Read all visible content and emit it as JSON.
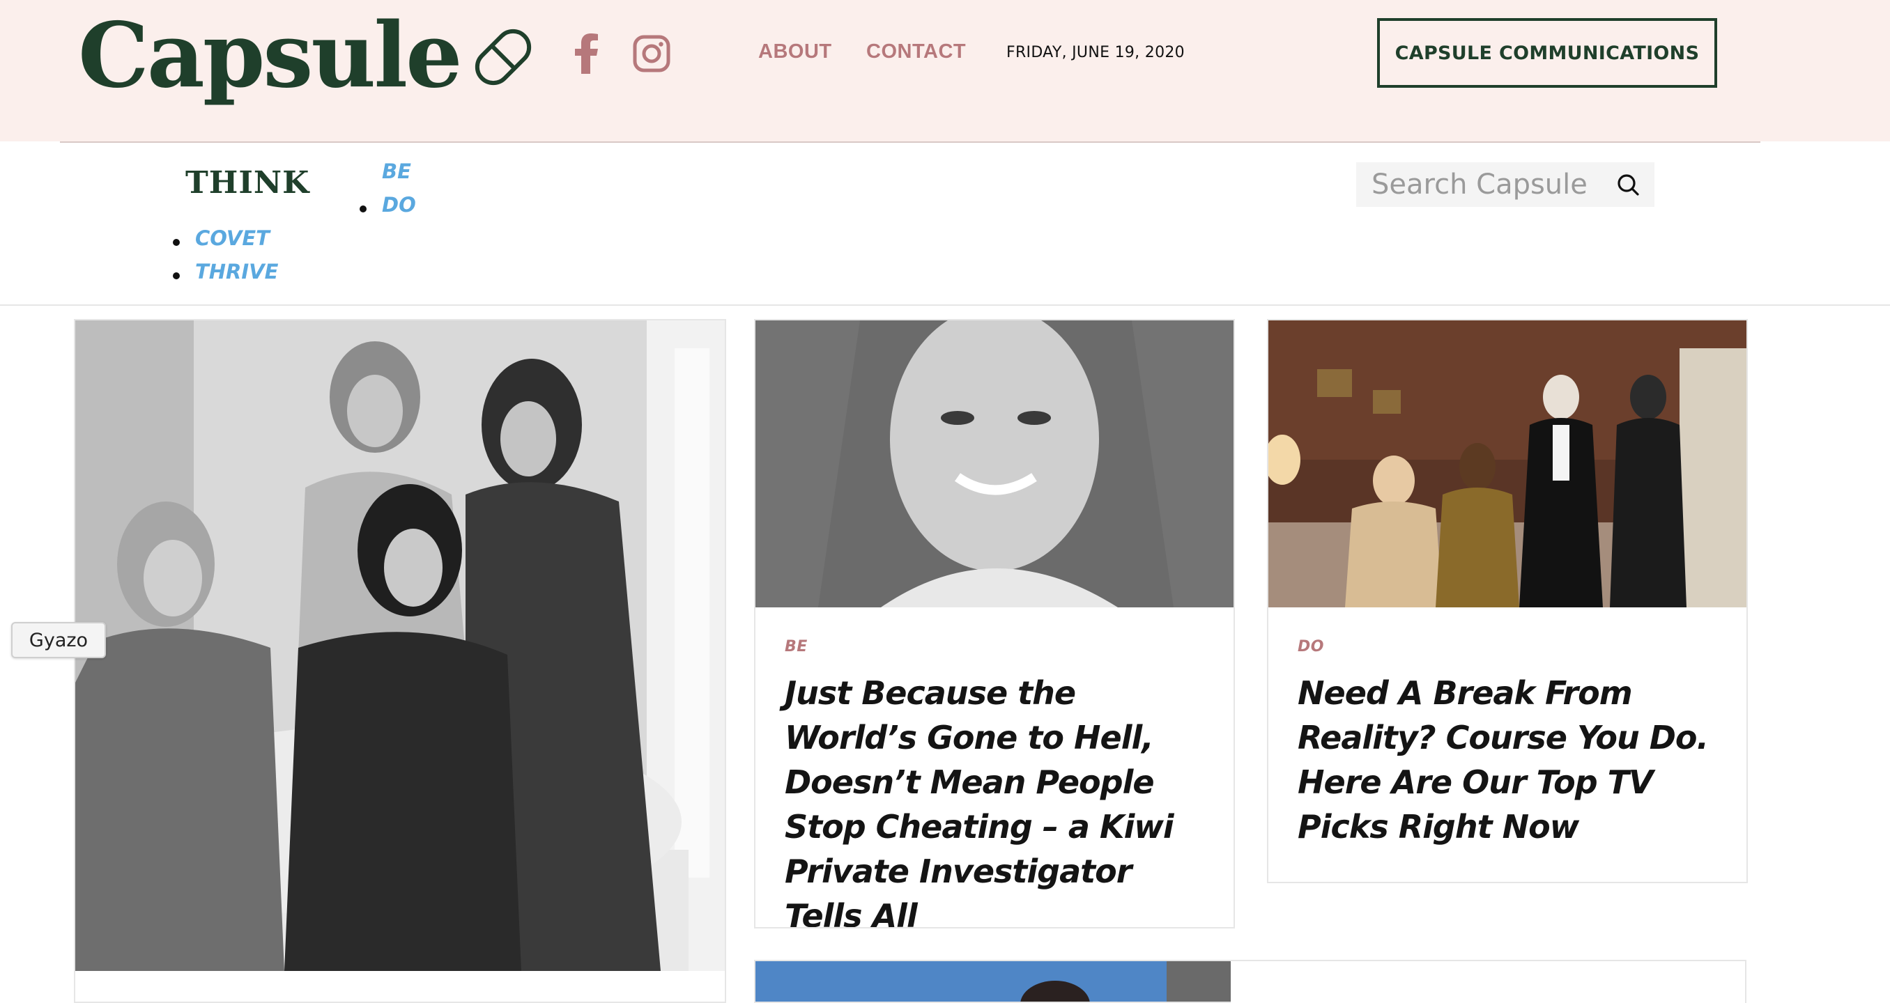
{
  "brand": {
    "logo_text": "Capsule",
    "colors": {
      "primary": "#1f3f2b",
      "accent": "#b6787b",
      "link": "#5aa8df",
      "header_bg": "#fbefec"
    }
  },
  "header": {
    "social": [
      {
        "icon": "facebook-icon"
      },
      {
        "icon": "instagram-icon"
      }
    ],
    "nav": {
      "about": "ABOUT",
      "contact": "CONTACT"
    },
    "date": "FRIDAY, JUNE 19, 2020",
    "cta_label": "CAPSULE COMMUNICATIONS"
  },
  "categories": {
    "think": "THINK",
    "be": "BE",
    "do": "DO",
    "covet": "COVET",
    "thrive": "THRIVE"
  },
  "search": {
    "placeholder": "Search Capsule",
    "icon": "search-icon"
  },
  "articles": [
    {
      "tag": "BE",
      "title": "Just Because the World’s Gone to Hell, Doesn’t Mean People Stop Cheating – a Kiwi Private Investigator Tells All"
    },
    {
      "tag": "DO",
      "title": "Need A Break From Reality? Course You Do. Here Are Our Top TV Picks Right Now"
    }
  ],
  "overlay": {
    "gyazo_label": "Gyazo"
  }
}
